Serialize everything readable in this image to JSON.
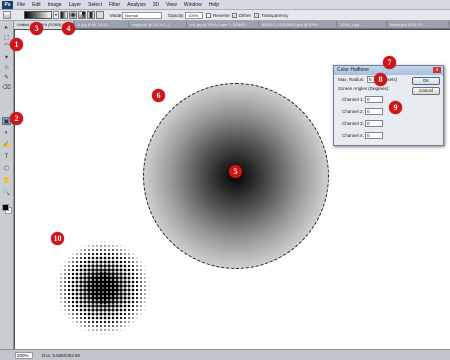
{
  "app": {
    "logo": "Ps",
    "menu": [
      "File",
      "Edit",
      "Image",
      "Layer",
      "Select",
      "Filter",
      "Analysis",
      "3D",
      "View",
      "Window",
      "Help"
    ]
  },
  "options": {
    "mode_label": "Mode:",
    "mode_value": "Normal",
    "opacity_label": "Opacity:",
    "opacity_value": "100%",
    "reverse_label": "Reverse",
    "dither_label": "Dither",
    "transparency_label": "Transparency",
    "dither_checked": "✓",
    "transparency_checked": "✓"
  },
  "tabs": [
    "Untitled-1 @ 200% (RGB/8) *",
    "11.jpg @ 66.7% (G...",
    "cmyk.psd @ 16.7% (...)",
    "ex1.jpg @ 100% (Layer 1, RGB/8) *",
    "BB0010_LIE1129501.psd @ 100%...",
    "100%, 1.jpg ...",
    "thumb.psd @ 66.7%..."
  ],
  "tools": [
    "▸",
    "⬚",
    "⌒",
    "✦",
    "⊹",
    "✎",
    "⌫",
    "▣",
    "◐",
    "✍",
    "T",
    "⬡",
    "✋",
    "🔍"
  ],
  "dialog": {
    "title": "Color Halftone",
    "close": "x",
    "max_radius_label": "Max. Radius:",
    "max_radius_value": "8",
    "max_radius_unit": "(Pixels)",
    "screen_angles_label": "Screen Angles (Degrees):",
    "channels": [
      {
        "label": "Channel 1:",
        "value": "0"
      },
      {
        "label": "Channel 2:",
        "value": "0"
      },
      {
        "label": "Channel 3:",
        "value": "0"
      },
      {
        "label": "Channel 4:",
        "value": "0"
      }
    ],
    "ok_label": "OK",
    "cancel_label": "Cancel"
  },
  "status": {
    "zoom": "200%",
    "doc": "Doc: 5.93M/383.8K"
  },
  "callouts": [
    "1",
    "2",
    "3",
    "4",
    "5",
    "6",
    "7",
    "8",
    "9",
    "10"
  ],
  "colors": {
    "callout": "#d0141a",
    "workspace": "#535353",
    "dialog_bg": "#e8ebf0"
  }
}
